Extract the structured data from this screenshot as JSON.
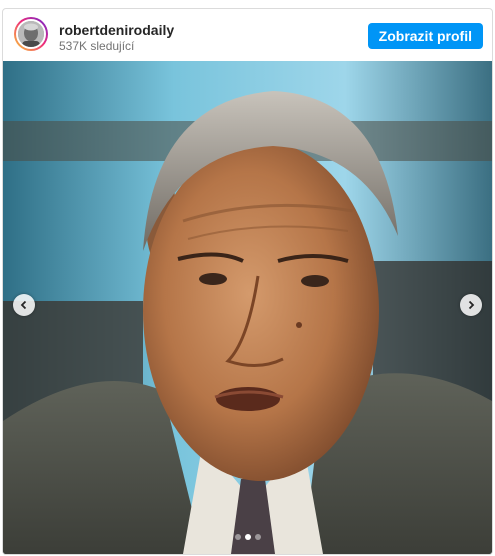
{
  "post": {
    "username": "robertdenirodaily",
    "followers": "537K sledující",
    "profile_button": "Zobrazit profil",
    "carousel": {
      "total_slides": 3,
      "active_slide": 2,
      "prev_icon": "chevron-left-icon",
      "next_icon": "chevron-right-icon"
    },
    "colors": {
      "accent": "#0095f6",
      "text_primary": "#262626",
      "text_secondary": "#737373",
      "border": "#dbdbdb"
    }
  }
}
